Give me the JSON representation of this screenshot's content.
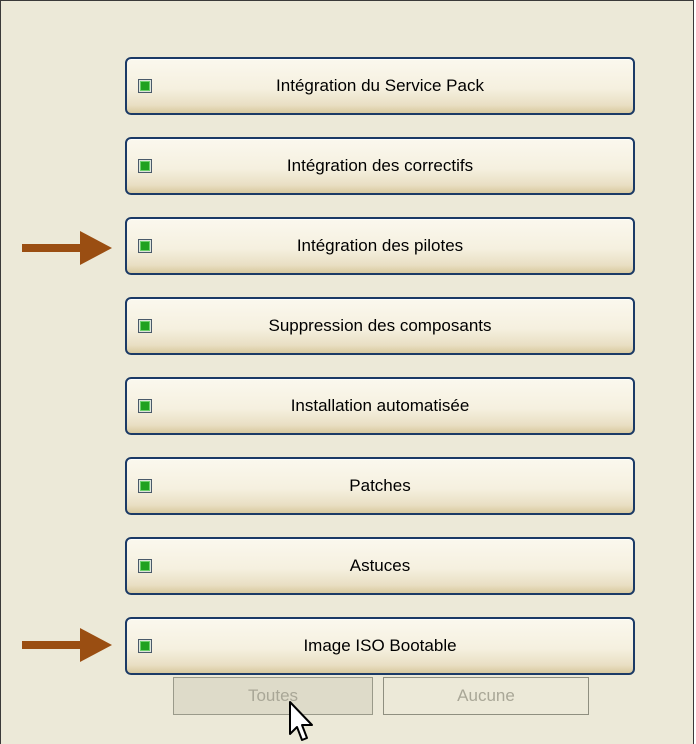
{
  "tasks": [
    {
      "label": "Intégration du Service Pack",
      "checked": true
    },
    {
      "label": "Intégration des correctifs",
      "checked": true
    },
    {
      "label": "Intégration des pilotes",
      "checked": true,
      "highlighted": true
    },
    {
      "label": "Suppression des composants",
      "checked": true
    },
    {
      "label": "Installation automatisée",
      "checked": true
    },
    {
      "label": "Patches",
      "checked": true
    },
    {
      "label": "Astuces",
      "checked": true
    },
    {
      "label": "Image ISO Bootable",
      "checked": true,
      "highlighted": true
    }
  ],
  "buttons": {
    "all_label": "Toutes",
    "none_label": "Aucune"
  },
  "colors": {
    "arrow": "#9a4e12",
    "checkbox_fill": "#21a121",
    "button_border": "#1b3a66",
    "panel_background": "#ece9d8"
  }
}
